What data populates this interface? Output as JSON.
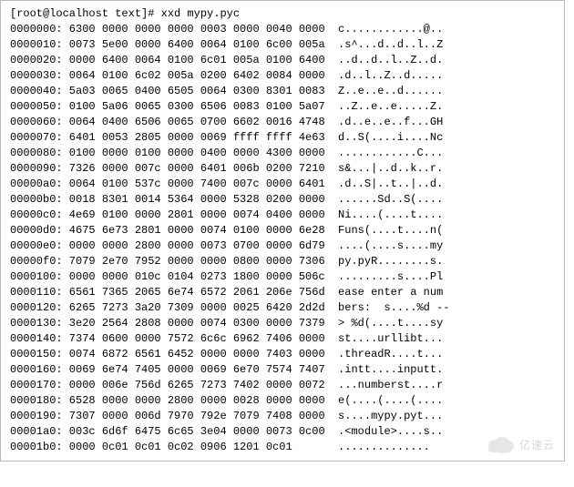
{
  "prompt": "[root@localhost text]# xxd mypy.pyc",
  "lines": [
    {
      "offset": "0000000:",
      "hex": "6300 0000 0000 0000 0003 0000 0040 0000",
      "ascii": "c............@.."
    },
    {
      "offset": "0000010:",
      "hex": "0073 5e00 0000 6400 0064 0100 6c00 005a",
      "ascii": ".s^...d..d..l..Z"
    },
    {
      "offset": "0000020:",
      "hex": "0000 6400 0064 0100 6c01 005a 0100 6400",
      "ascii": "..d..d..l..Z..d."
    },
    {
      "offset": "0000030:",
      "hex": "0064 0100 6c02 005a 0200 6402 0084 0000",
      "ascii": ".d..l..Z..d....."
    },
    {
      "offset": "0000040:",
      "hex": "5a03 0065 0400 6505 0064 0300 8301 0083",
      "ascii": "Z..e..e..d......"
    },
    {
      "offset": "0000050:",
      "hex": "0100 5a06 0065 0300 6506 0083 0100 5a07",
      "ascii": "..Z..e..e.....Z."
    },
    {
      "offset": "0000060:",
      "hex": "0064 0400 6506 0065 0700 6602 0016 4748",
      "ascii": ".d..e..e..f...GH"
    },
    {
      "offset": "0000070:",
      "hex": "6401 0053 2805 0000 0069 ffff ffff 4e63",
      "ascii": "d..S(....i....Nc"
    },
    {
      "offset": "0000080:",
      "hex": "0100 0000 0100 0000 0400 0000 4300 0000",
      "ascii": "............C..."
    },
    {
      "offset": "0000090:",
      "hex": "7326 0000 007c 0000 6401 006b 0200 7210",
      "ascii": "s&...|..d..k..r."
    },
    {
      "offset": "00000a0:",
      "hex": "0064 0100 537c 0000 7400 007c 0000 6401",
      "ascii": ".d..S|..t..|..d."
    },
    {
      "offset": "00000b0:",
      "hex": "0018 8301 0014 5364 0000 5328 0200 0000",
      "ascii": "......Sd..S(...."
    },
    {
      "offset": "00000c0:",
      "hex": "4e69 0100 0000 2801 0000 0074 0400 0000",
      "ascii": "Ni....(....t...."
    },
    {
      "offset": "00000d0:",
      "hex": "4675 6e73 2801 0000 0074 0100 0000 6e28",
      "ascii": "Funs(....t....n("
    },
    {
      "offset": "00000e0:",
      "hex": "0000 0000 2800 0000 0073 0700 0000 6d79",
      "ascii": "....(....s....my"
    },
    {
      "offset": "00000f0:",
      "hex": "7079 2e70 7952 0000 0000 0800 0000 7306",
      "ascii": "py.pyR........s."
    },
    {
      "offset": "0000100:",
      "hex": "0000 0000 010c 0104 0273 1800 0000 506c",
      "ascii": ".........s....Pl"
    },
    {
      "offset": "0000110:",
      "hex": "6561 7365 2065 6e74 6572 2061 206e 756d",
      "ascii": "ease enter a num"
    },
    {
      "offset": "0000120:",
      "hex": "6265 7273 3a20 7309 0000 0025 6420 2d2d",
      "ascii": "bers:  s....%d --"
    },
    {
      "offset": "0000130:",
      "hex": "3e20 2564 2808 0000 0074 0300 0000 7379",
      "ascii": "> %d(....t....sy"
    },
    {
      "offset": "0000140:",
      "hex": "7374 0600 0000 7572 6c6c 6962 7406 0000",
      "ascii": "st....urllibt..."
    },
    {
      "offset": "0000150:",
      "hex": "0074 6872 6561 6452 0000 0000 7403 0000",
      "ascii": ".threadR....t..."
    },
    {
      "offset": "0000160:",
      "hex": "0069 6e74 7405 0000 0069 6e70 7574 7407",
      "ascii": ".intt....inputt."
    },
    {
      "offset": "0000170:",
      "hex": "0000 006e 756d 6265 7273 7402 0000 0072",
      "ascii": "...numberst....r"
    },
    {
      "offset": "0000180:",
      "hex": "6528 0000 0000 2800 0000 0028 0000 0000",
      "ascii": "e(....(....(...."
    },
    {
      "offset": "0000190:",
      "hex": "7307 0000 006d 7970 792e 7079 7408 0000",
      "ascii": "s....mypy.pyt..."
    },
    {
      "offset": "00001a0:",
      "hex": "003c 6d6f 6475 6c65 3e04 0000 0073 0c00",
      "ascii": ".<module>....s.."
    },
    {
      "offset": "00001b0:",
      "hex": "0000 0c01 0c01 0c02 0906 1201 0c01",
      "ascii": ".............."
    }
  ],
  "watermark": "亿速云"
}
